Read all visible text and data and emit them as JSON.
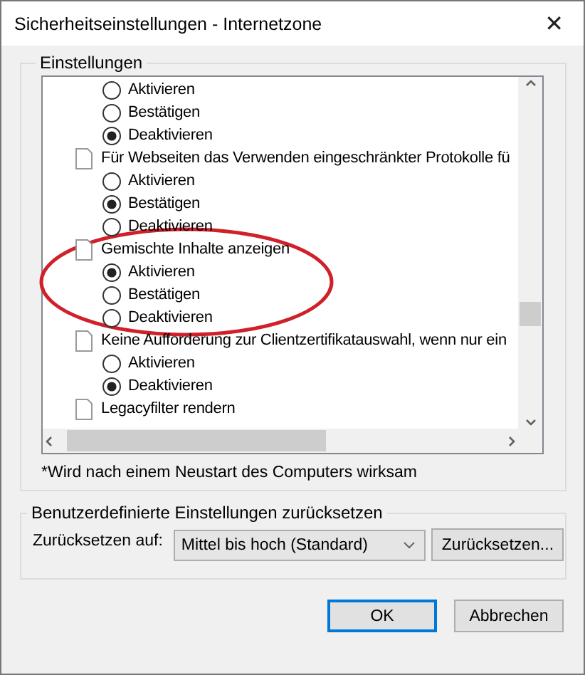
{
  "window": {
    "title": "Sicherheitseinstellungen - Internetzone",
    "close": "✕"
  },
  "settings_group": {
    "title": "Einstellungen",
    "items": [
      {
        "kind": "radio",
        "label": "Aktivieren",
        "selected": false
      },
      {
        "kind": "radio",
        "label": "Bestätigen",
        "selected": false
      },
      {
        "kind": "radio",
        "label": "Deaktivieren",
        "selected": true
      },
      {
        "kind": "setting",
        "label": "Für Webseiten das Verwenden eingeschränkter Protokolle fü"
      },
      {
        "kind": "radio",
        "label": "Aktivieren",
        "selected": false
      },
      {
        "kind": "radio",
        "label": "Bestätigen",
        "selected": true
      },
      {
        "kind": "radio",
        "label": "Deaktivieren",
        "selected": false
      },
      {
        "kind": "setting",
        "label": "Gemischte Inhalte anzeigen"
      },
      {
        "kind": "radio",
        "label": "Aktivieren",
        "selected": true
      },
      {
        "kind": "radio",
        "label": "Bestätigen",
        "selected": false
      },
      {
        "kind": "radio",
        "label": "Deaktivieren",
        "selected": false
      },
      {
        "kind": "setting",
        "label": "Keine Aufforderung zur Clientzertifikatauswahl, wenn nur ein"
      },
      {
        "kind": "radio",
        "label": "Aktivieren",
        "selected": false
      },
      {
        "kind": "radio",
        "label": "Deaktivieren",
        "selected": true
      },
      {
        "kind": "setting",
        "label": "Legacyfilter rendern"
      }
    ],
    "note": "*Wird nach einem Neustart des Computers wirksam"
  },
  "reset_group": {
    "title": "Benutzerdefinierte Einstellungen zurücksetzen",
    "label": "Zurücksetzen auf:",
    "dropdown_value": "Mittel bis hoch (Standard)",
    "button": "Zurücksetzen..."
  },
  "buttons": [
    {
      "label": "OK",
      "default": true
    },
    {
      "label": "Abbrechen",
      "default": false
    }
  ]
}
